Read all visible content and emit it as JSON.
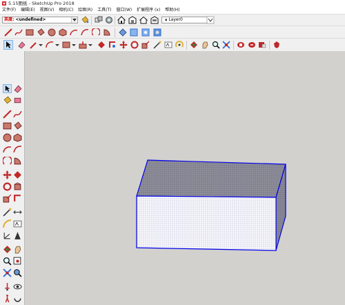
{
  "window": {
    "title": "5.15图纸 - SketchUp Pro 2018",
    "app_icon": "sketchup-logo-icon"
  },
  "menubar": {
    "items": [
      "文件(F)",
      "编辑(E)",
      "视图(V)",
      "相机(C)",
      "绘图(R)",
      "工具(T)",
      "窗口(W)",
      "扩展程序 (x)",
      "帮助(H)"
    ]
  },
  "toolbar": {
    "material_label": "英度:",
    "material_value": "<undefined>",
    "layer_value": "Layer0",
    "accent_red": "#c0282a",
    "accent_blue": "#2f6fd6"
  },
  "viewport": {
    "background": "#d2d1ce",
    "edge_color": "#0000e8",
    "top_face_color": "#8f8f99",
    "front_face_color": "#f7f7fb",
    "side_face_color": "#8c8c96"
  }
}
